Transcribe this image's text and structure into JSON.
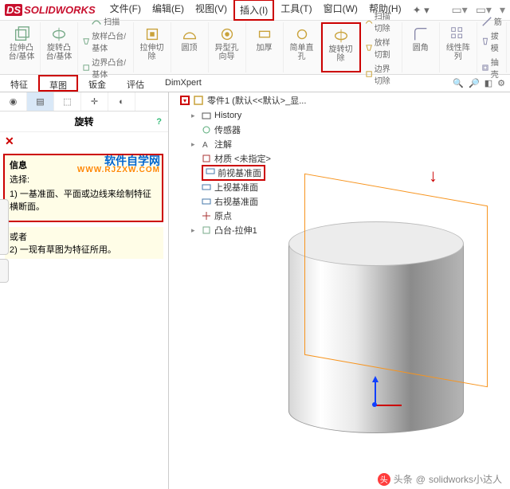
{
  "app": {
    "name": "SOLIDWORKS"
  },
  "menu": {
    "file": "文件(F)",
    "edit": "编辑(E)",
    "view": "视图(V)",
    "insert": "插入(I)",
    "tools": "工具(T)",
    "window": "窗口(W)",
    "help": "帮助(H)"
  },
  "ribbon": {
    "extrude": "拉伸凸\n台/基体",
    "revolve": "旋转凸\n台/基体",
    "sweep": "扫描",
    "loft": "放样凸台/基体",
    "boundary": "边界凸台/基体",
    "extrudeCut": "拉伸切\n除",
    "holeWiz": "异型孔\n向导",
    "revolveCut": "旋转切\n除",
    "sweepCut": "扫描切除",
    "loftCut": "放样切割",
    "boundaryCut": "边界切除",
    "fillet": "圆角",
    "linPattern": "线性阵\n列",
    "rib": "筋",
    "draft": "拔模",
    "shell": "抽壳",
    "dome": "圆顶",
    "thicken": "加厚",
    "simpleHole": "简单直\n孔"
  },
  "tabs": {
    "feature": "特征",
    "sketch": "草图",
    "sheetmetal": "钣金",
    "evaluate": "评估",
    "dimxpert": "DimXpert"
  },
  "panel": {
    "title": "旋转",
    "infoTitle": "信息",
    "select": "选择:",
    "line1": "1) 一基准面、平面或边线来绘制特征横断面。",
    "or": "或者",
    "line2": "2) 一现有草图为特征所用。"
  },
  "watermark": {
    "top": "软件自学网",
    "sub": "WWW.RJZXW.COM"
  },
  "tree": {
    "root": "零件1 (默认<<默认>_显...",
    "history": "History",
    "sensors": "传感器",
    "annotations": "注解",
    "material": "材质 <未指定>",
    "front": "前视基准面",
    "top": "上视基准面",
    "right": "右视基准面",
    "origin": "原点",
    "boss": "凸台-拉伸1"
  },
  "attribution": {
    "prefix": "头条",
    "author": "solidworks小达人"
  }
}
